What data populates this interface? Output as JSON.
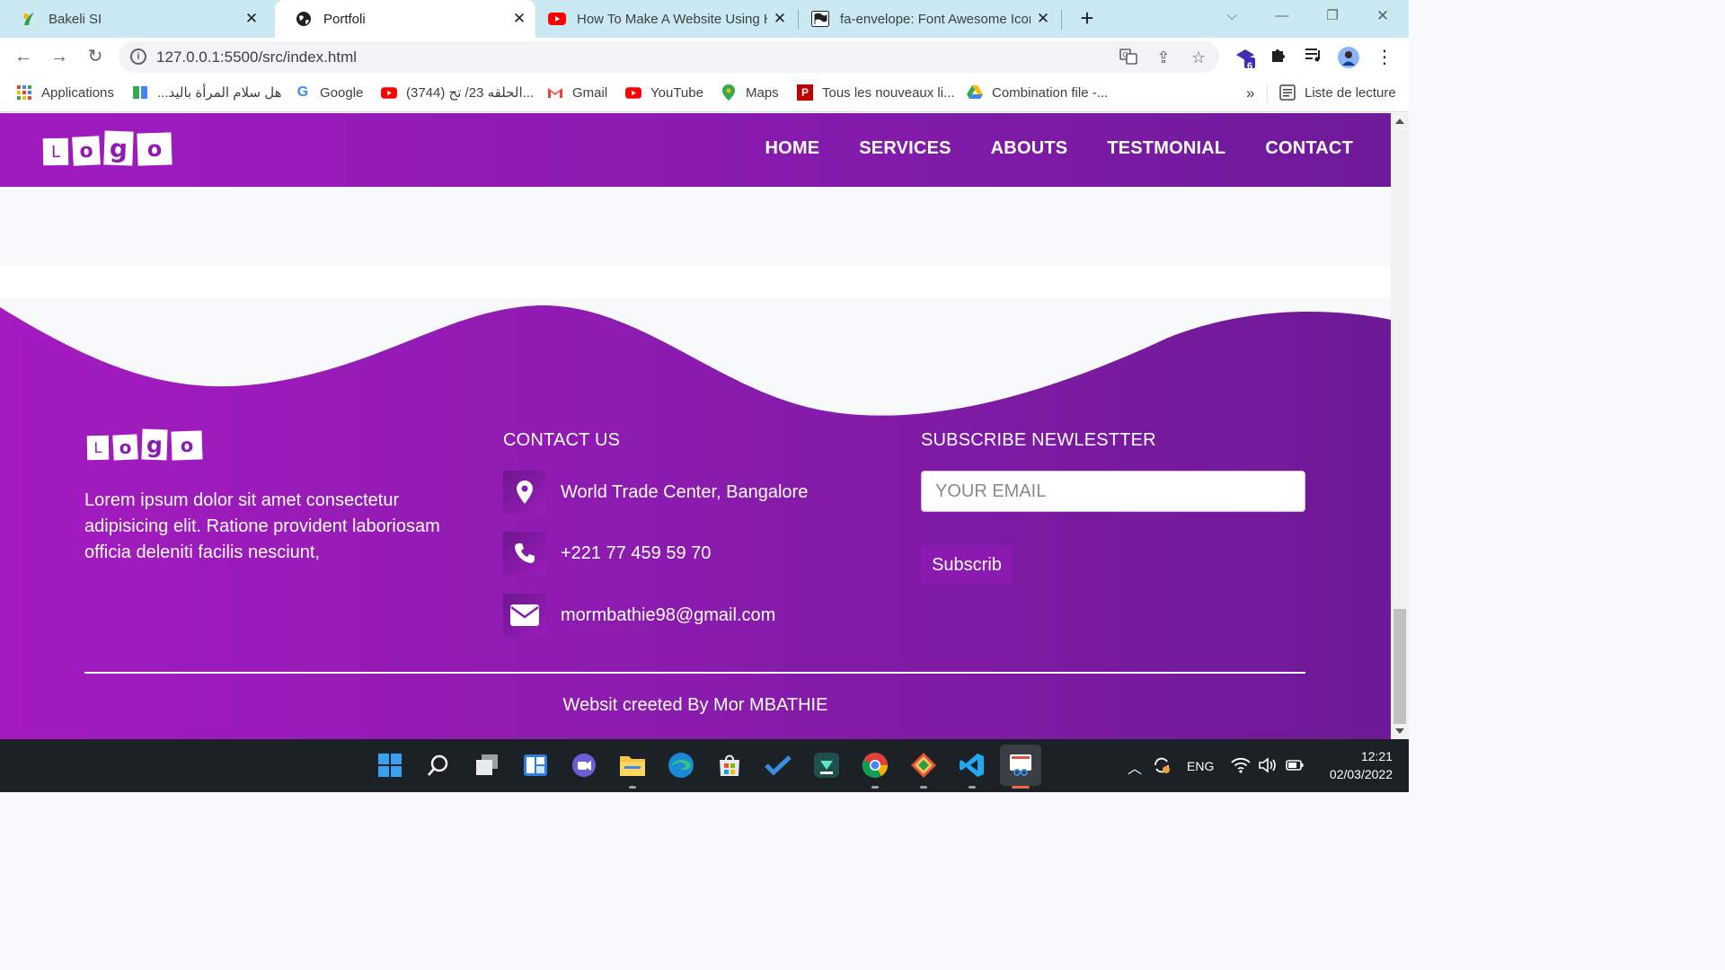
{
  "browser": {
    "tabs": [
      {
        "title": "Bakeli SI",
        "active": false
      },
      {
        "title": "Portfoli",
        "active": true
      },
      {
        "title": "How To Make A Website Using H",
        "active": false
      },
      {
        "title": "fa-envelope: Font Awesome Icon",
        "active": false
      }
    ],
    "url": "127.0.0.1:5500/src/index.html",
    "extension_badge": "6",
    "bookmarks": [
      "Applications",
      "هل سلام المرأة باليد...",
      "Google",
      "(3744) الحلقه 23/ تح...",
      "Gmail",
      "YouTube",
      "Maps",
      "Tous les nouveaux li...",
      "Combination file -..."
    ],
    "bookmarks_overflow": "»",
    "reading_list": "Liste de lecture"
  },
  "site": {
    "logo_letters": [
      "L",
      "o",
      "g",
      "o"
    ],
    "nav": [
      "HOME",
      "SERVICES",
      "ABOUTS",
      "TESTMONIAL",
      "CONTACT"
    ],
    "footer": {
      "about_text": "Lorem ipsum dolor sit amet consectetur adipisicing elit. Ratione provident laboriosam officia deleniti facilis nesciunt,",
      "contact_heading": "CONTACT US",
      "contacts": [
        {
          "icon": "map-marker-icon",
          "text": "World Trade Center, Bangalore"
        },
        {
          "icon": "phone-icon",
          "text": "+221 77 459 59 70"
        },
        {
          "icon": "envelope-icon",
          "text": "mormbathie98@gmail.com"
        }
      ],
      "newsletter_heading": "SUBSCRIBE NEWLESTTER",
      "email_placeholder": "YOUR EMAIL",
      "subscribe_label": "Subscrib",
      "copyright": "Websit creeted By Mor MBATHIE"
    },
    "colors": {
      "purple_start": "#a11bbf",
      "purple_end": "#6e1a9a"
    }
  },
  "taskbar": {
    "language": "ENG",
    "time": "12:21",
    "date": "02/03/2022"
  }
}
